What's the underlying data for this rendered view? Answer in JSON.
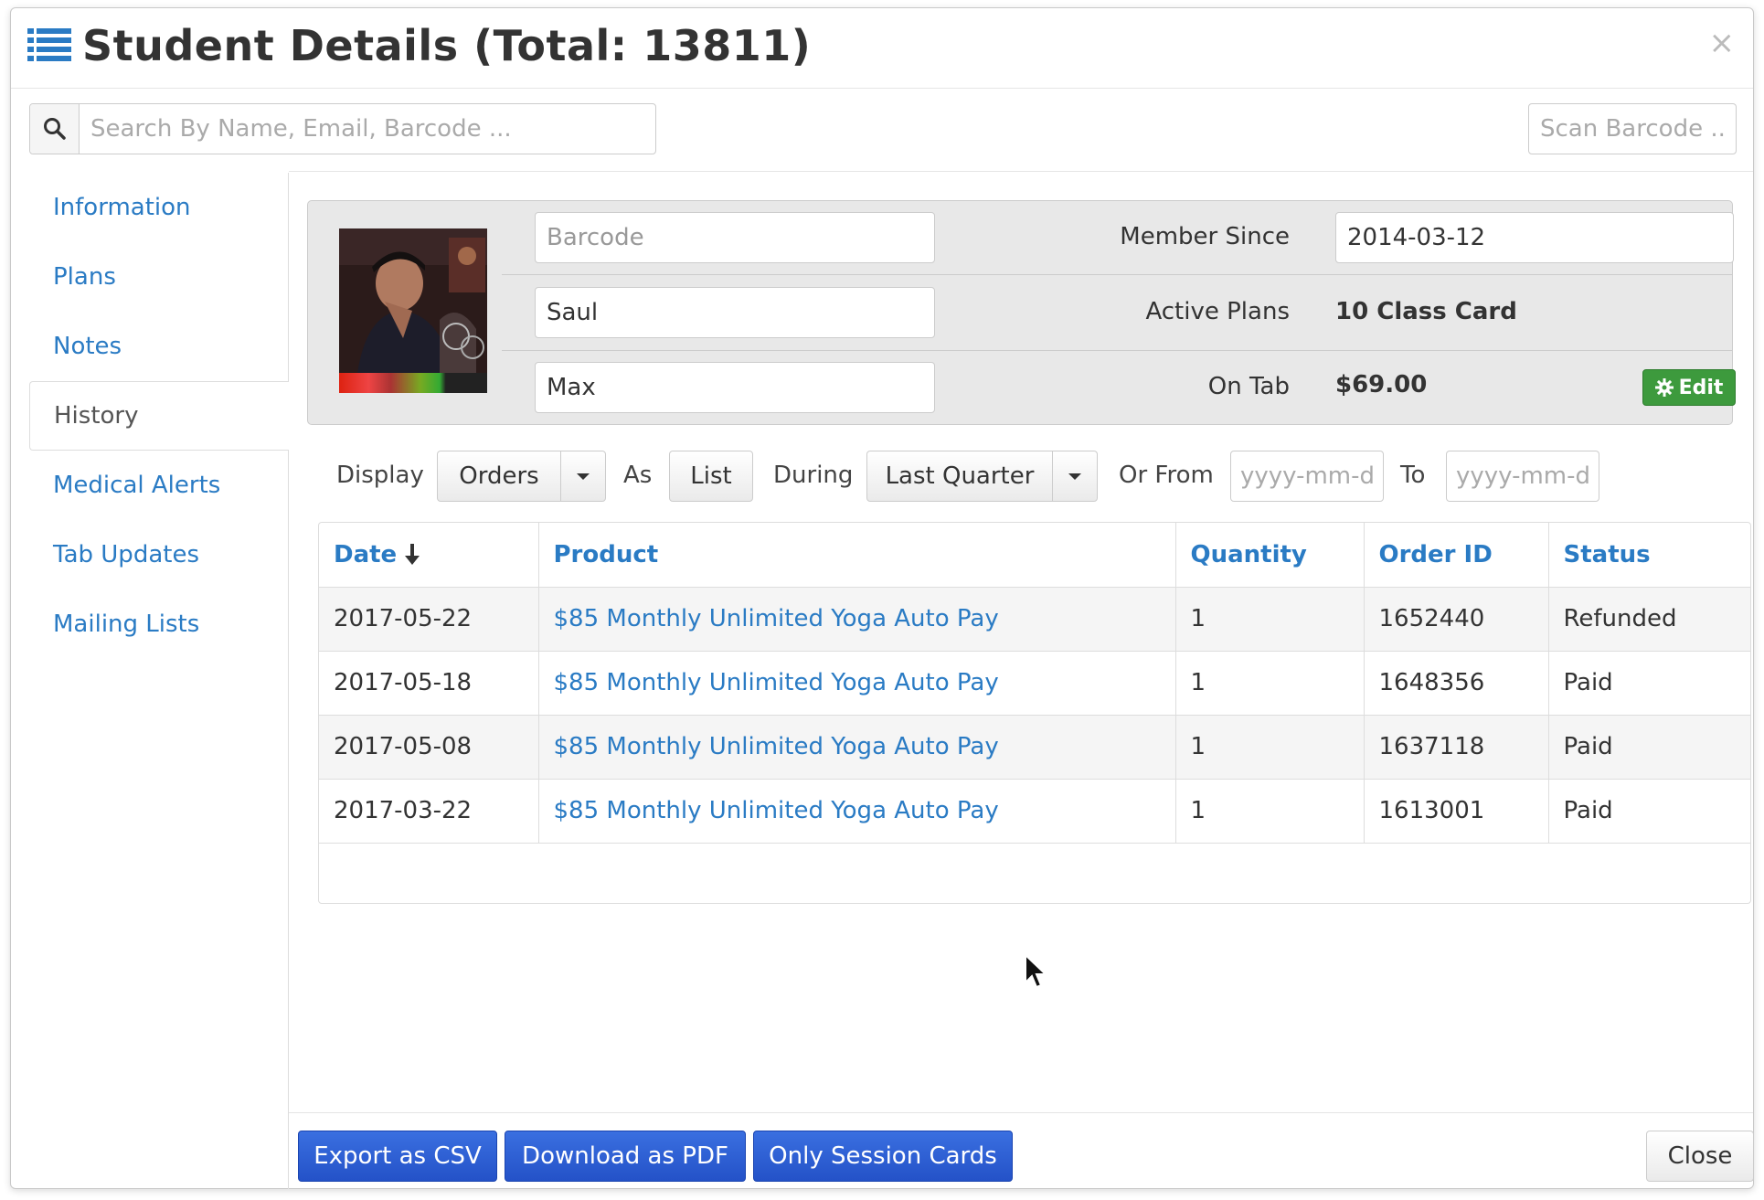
{
  "header": {
    "title": "Student Details (Total: 13811)",
    "close_symbol": "×",
    "icon": "list-icon"
  },
  "search": {
    "placeholder": "Search By Name, Email, Barcode ...",
    "icon": "search-icon",
    "scan_placeholder": "Scan Barcode ..."
  },
  "sidebar": {
    "items": [
      {
        "label": "Information"
      },
      {
        "label": "Plans"
      },
      {
        "label": "Notes"
      },
      {
        "label": "History",
        "active": true
      },
      {
        "label": "Medical Alerts"
      },
      {
        "label": "Tab Updates"
      },
      {
        "label": "Mailing Lists"
      }
    ]
  },
  "profile": {
    "barcode_placeholder": "Barcode",
    "first_name": "Saul",
    "last_name": "Max",
    "member_since_label": "Member Since",
    "member_since_value": "2014-03-12",
    "active_plans_label": "Active Plans",
    "active_plans_value": "10 Class Card",
    "on_tab_label": "On Tab",
    "on_tab_value": "$69.00",
    "edit_label": "Edit",
    "edit_icon": "gear-icon"
  },
  "filters": {
    "display_label": "Display",
    "display_value": "Orders",
    "as_label": "As",
    "as_value": "List",
    "during_label": "During",
    "during_value": "Last Quarter",
    "or_from_label": "Or From",
    "from_placeholder": "yyyy-mm-dd",
    "to_label": "To",
    "to_placeholder": "yyyy-mm-dd"
  },
  "table": {
    "columns": [
      "Date",
      "Product",
      "Quantity",
      "Order ID",
      "Status"
    ],
    "rows": [
      [
        "2017-05-22",
        "$85 Monthly Unlimited Yoga Auto Pay",
        "1",
        "1652440",
        "Refunded"
      ],
      [
        "2017-05-18",
        "$85 Monthly Unlimited Yoga Auto Pay",
        "1",
        "1648356",
        "Paid"
      ],
      [
        "2017-05-08",
        "$85 Monthly Unlimited Yoga Auto Pay",
        "1",
        "1637118",
        "Paid"
      ],
      [
        "2017-03-22",
        "$85 Monthly Unlimited Yoga Auto Pay",
        "1",
        "1613001",
        "Paid"
      ]
    ]
  },
  "footer": {
    "export_csv": "Export as CSV",
    "download_pdf": "Download as PDF",
    "only_session_cards": "Only Session Cards",
    "close": "Close"
  },
  "colors": {
    "link": "#2a7bc4",
    "primary": "#2452c8",
    "success": "#3d9a3d"
  }
}
